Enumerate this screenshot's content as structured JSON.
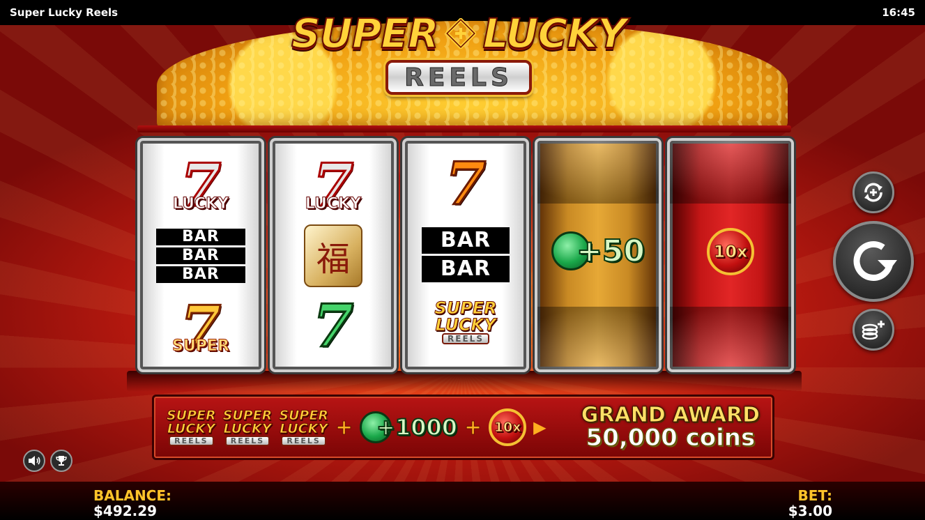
{
  "window": {
    "title": "Super Lucky Reels",
    "clock": "16:45"
  },
  "logo": {
    "word1": "SUPER",
    "word2": "LUCKY",
    "subtitle": "REELS"
  },
  "reels": {
    "reel1": {
      "top": {
        "glyph": "7",
        "label": "LUCKY"
      },
      "middle": [
        "BAR",
        "BAR",
        "BAR"
      ],
      "bottom": {
        "glyph": "7",
        "label": "SUPER"
      }
    },
    "reel2": {
      "top": {
        "glyph": "7",
        "label": "LUCKY"
      },
      "middle": {
        "glyph": "福"
      },
      "bottom": {
        "glyph": "7"
      }
    },
    "reel3": {
      "top": {
        "glyph": "7"
      },
      "middle": [
        "BAR",
        "BAR"
      ],
      "bottom": {
        "word1": "SUPER",
        "word2": "LUCKY",
        "word3": "REELS"
      }
    },
    "reel4": {
      "value": "+50"
    },
    "reel5": {
      "value": "10x"
    }
  },
  "award": {
    "logo_word1": "SUPER",
    "logo_word2": "LUCKY",
    "logo_word3": "REELS",
    "plus": "+",
    "coin_value": "+1000",
    "multiplier": "10x",
    "arrow": "▶",
    "grand_title": "GRAND AWARD",
    "grand_value": "50,000 coins"
  },
  "controls": {
    "autoplay_icon": "autoplay-icon",
    "spin_icon": "spin-icon",
    "bet_icon": "coin-stack-plus-icon",
    "sound_icon": "speaker-icon",
    "trophy_icon": "trophy-icon"
  },
  "footer": {
    "balance_label": "BALANCE:",
    "balance_value": "$492.29",
    "bet_label": "BET:",
    "bet_value": "$3.00"
  },
  "colors": {
    "gold": "#ffc42a",
    "red_bg": "#b3180f",
    "bar_black": "#000000"
  }
}
